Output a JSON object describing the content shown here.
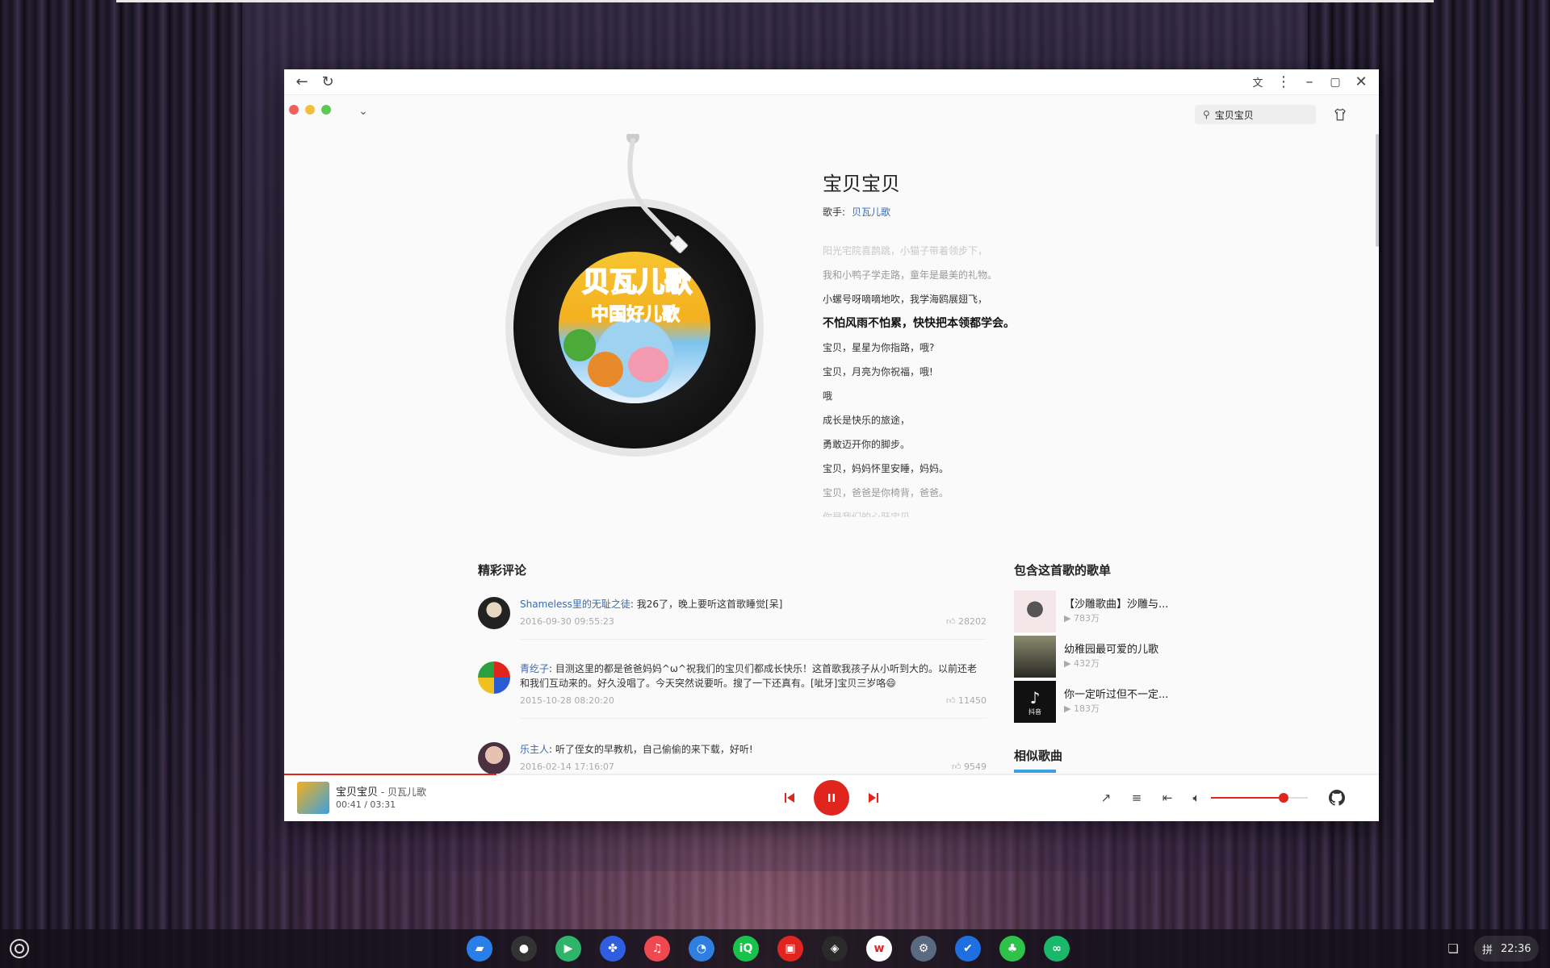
{
  "browser": {
    "back_icon": "back-arrow-icon",
    "reload_icon": "reload-icon",
    "translate_icon": "translate-icon",
    "menu_icon": "more-vert-icon"
  },
  "header": {
    "search_value": "宝贝宝贝"
  },
  "song": {
    "title": "宝贝宝贝",
    "singer_label": "歌手:",
    "singer": "贝瓦儿歌",
    "cover_text_1": "贝瓦儿歌",
    "cover_text_2": "中国好儿歌"
  },
  "lyrics": [
    {
      "text": "阳光宅院喜鹊跳，小猫子带着领步下，",
      "state": "fade2"
    },
    {
      "text": "我和小鸭子学走路，童年是最美的礼物。",
      "state": "fade1"
    },
    {
      "text": "小螺号呀嘀嘀地吹，我学海鸥展翅飞，",
      "state": "normal"
    },
    {
      "text": "不怕风雨不怕累，快快把本领都学会。",
      "state": "active"
    },
    {
      "text": "宝贝，星星为你指路，哦?",
      "state": "normal"
    },
    {
      "text": "宝贝，月亮为你祝福，哦!",
      "state": "normal"
    },
    {
      "text": "哦",
      "state": "normal"
    },
    {
      "text": "成长是快乐的旅途，",
      "state": "normal"
    },
    {
      "text": "勇敢迈开你的脚步。",
      "state": "normal"
    },
    {
      "text": "宝贝，妈妈怀里安睡，妈妈。",
      "state": "normal"
    },
    {
      "text": "宝贝，爸爸是你椅背，爸爸。",
      "state": "fade1"
    },
    {
      "text": "你是我们的心肝宝贝。",
      "state": "fade2"
    }
  ],
  "comments": {
    "title": "精彩评论",
    "items": [
      {
        "user": "Shameless里的无耻之徒",
        "text": "我26了，晚上要听这首歌睡觉[呆]",
        "time": "2016-09-30 09:55:23",
        "likes": "28202"
      },
      {
        "user": "青纥子",
        "text": "目测这里的都是爸爸妈妈^ω^祝我们的宝贝们都成长快乐！这首歌我孩子从小听到大的。以前还老和我们互动来的。好久没唱了。今天突然说要听。搜了一下还真有。[呲牙]宝贝三岁咯😄",
        "time": "2015-10-28 08:20:20",
        "likes": "11450"
      },
      {
        "user": "乐主人",
        "text": "听了侄女的早教机，自己偷偷的来下载，好听!",
        "time": "2016-02-14 17:16:07",
        "likes": "9549"
      }
    ]
  },
  "playlists": {
    "title": "包含这首歌的歌单",
    "items": [
      {
        "name": "【沙雕歌曲】沙雕与...",
        "count": "783万"
      },
      {
        "name": "幼稚园最可爱的儿歌",
        "count": "432万"
      },
      {
        "name": "你一定听过但不一定...",
        "count": "183万"
      }
    ],
    "cover_label_3": "抖音"
  },
  "similar": {
    "title": "相似歌曲"
  },
  "player": {
    "title": "宝贝宝贝",
    "separator": " - ",
    "artist": "贝瓦儿歌",
    "time": "00:41 / 03:31",
    "progress": 0.194,
    "volume": 0.75,
    "accent": "#e0251f"
  },
  "taskbar": {
    "ime": "拼",
    "clock": "22:36",
    "apps": [
      "files-icon",
      "music-disc-icon",
      "play-store-icon",
      "baidu-paw-icon",
      "apple-music-icon",
      "clock-icon",
      "iqiyi-icon",
      "shopping-bag-icon",
      "photo-editor-icon",
      "weibo-icon",
      "settings-gear-icon",
      "tasks-check-icon",
      "game-icon",
      "wave-app-icon"
    ]
  }
}
